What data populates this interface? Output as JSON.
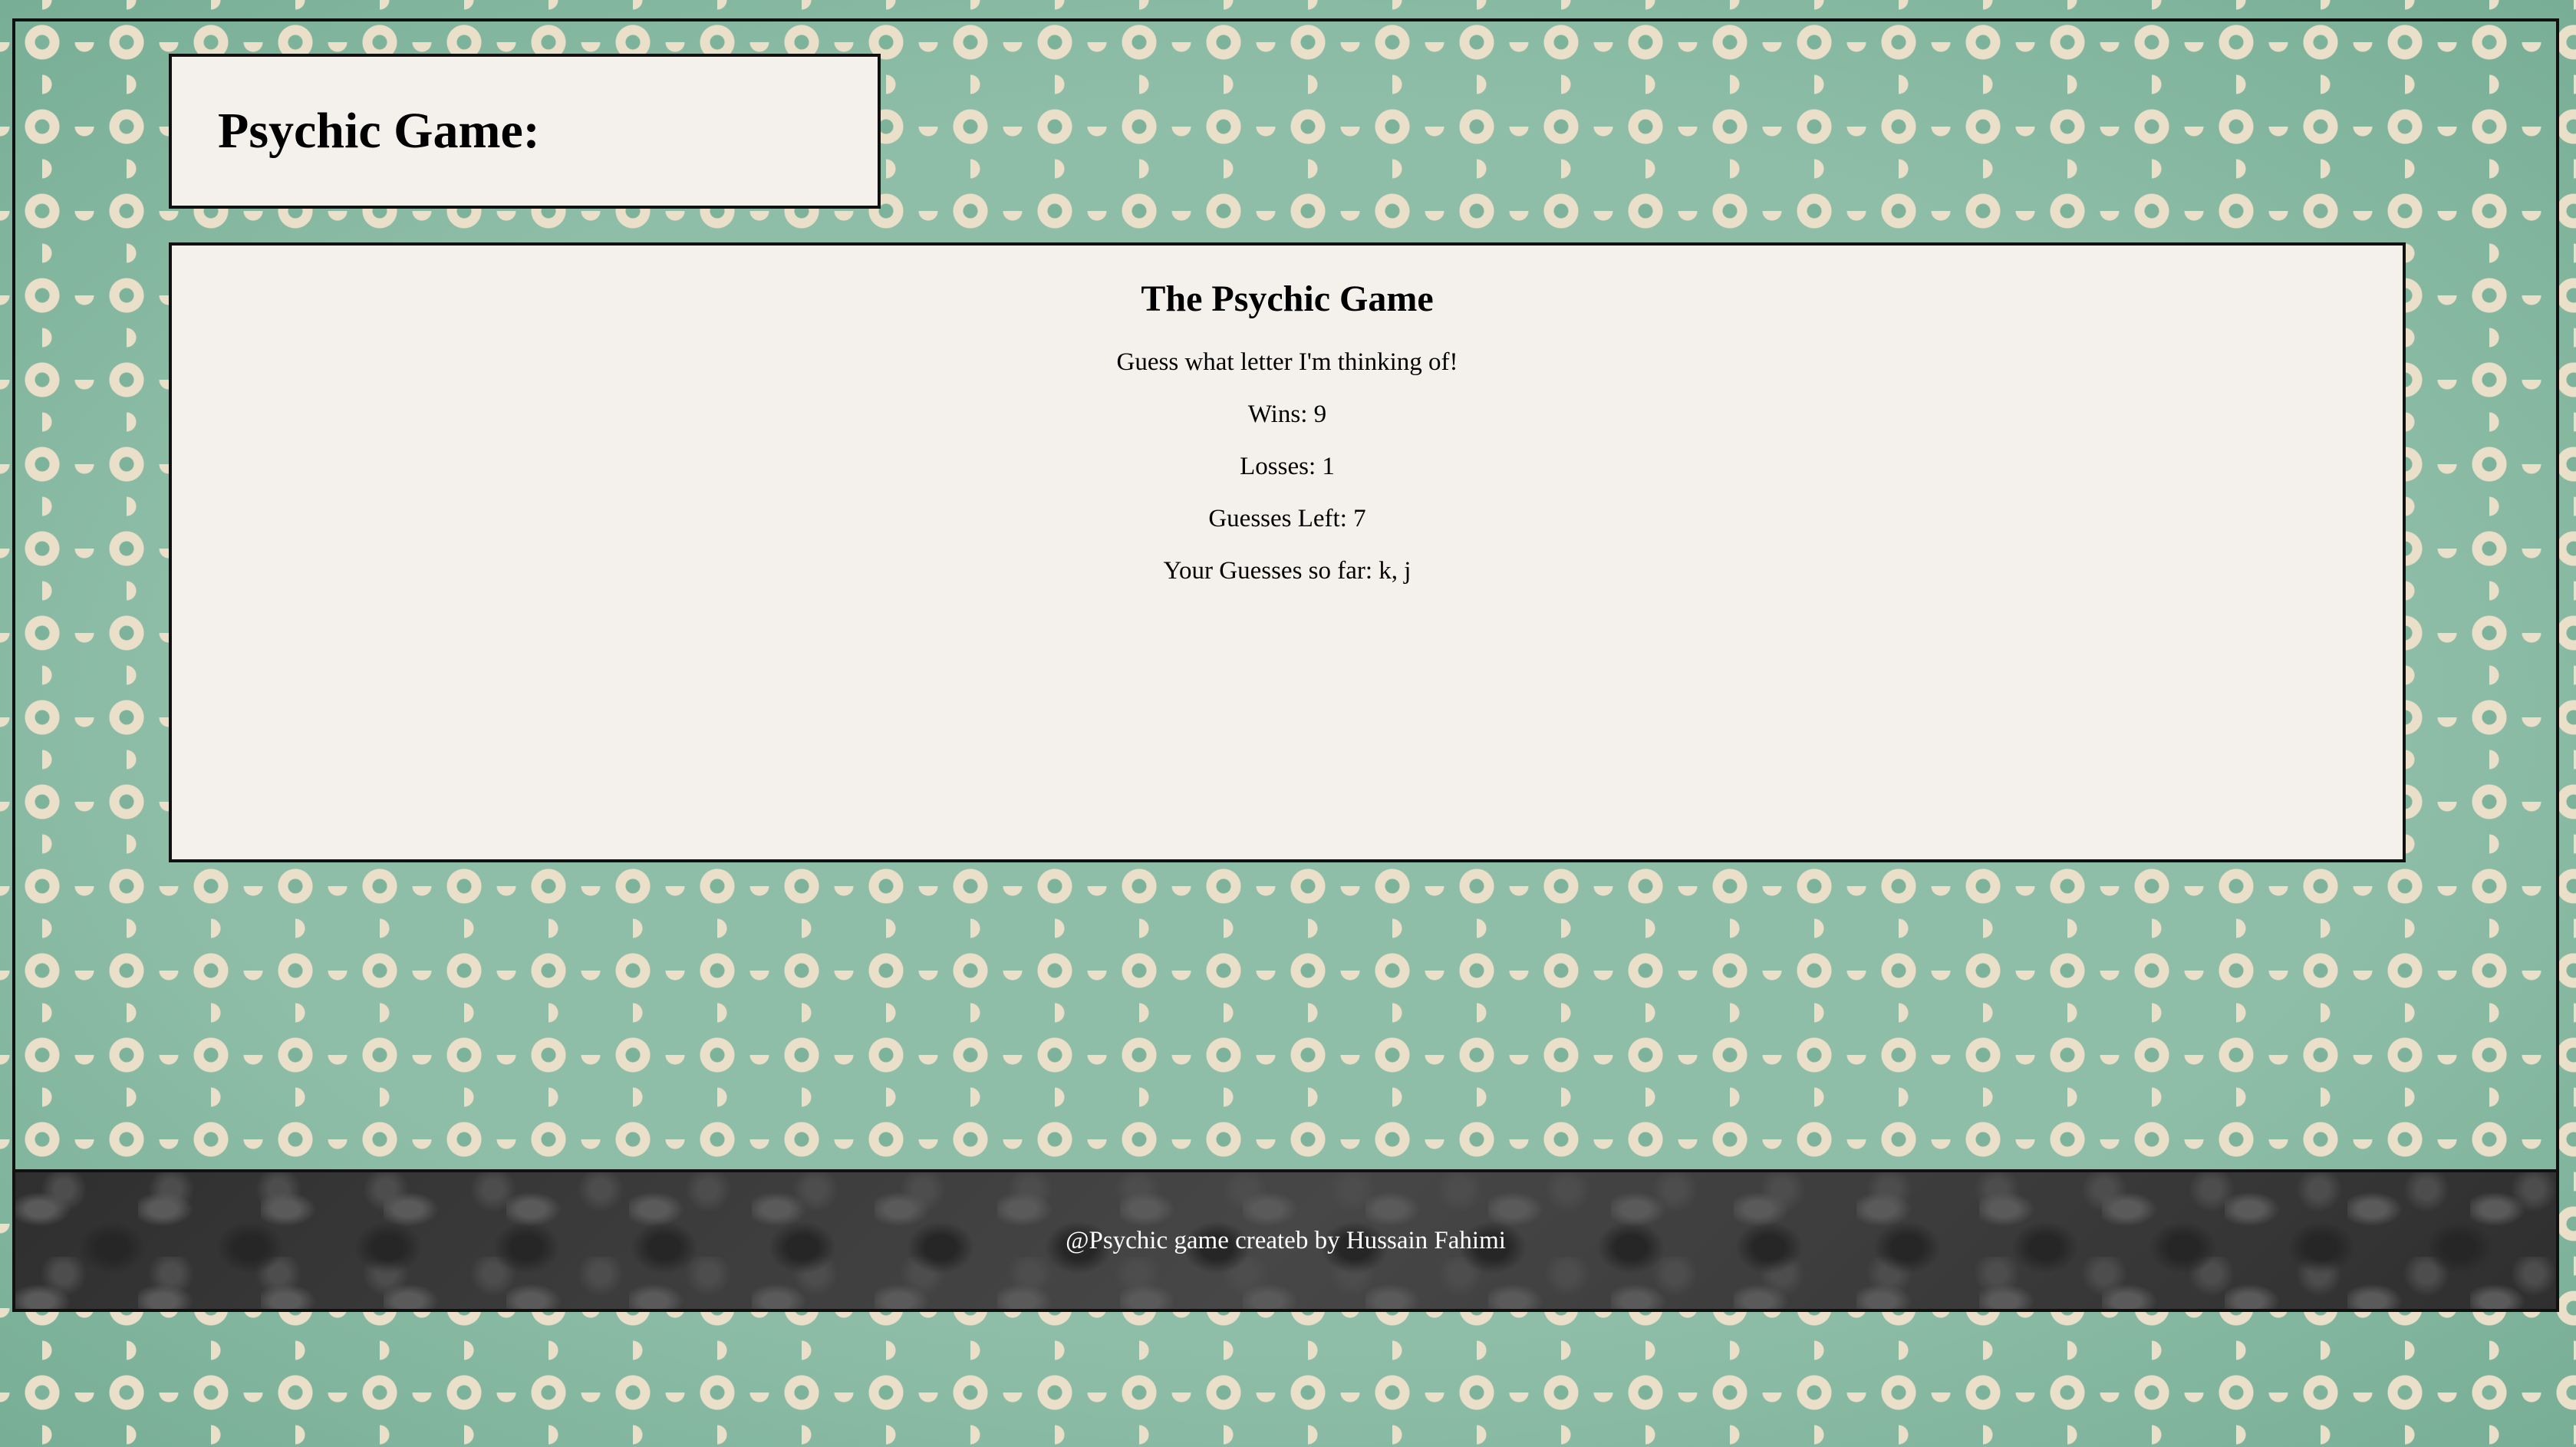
{
  "header": {
    "title": "Psychic Game:"
  },
  "game": {
    "title": "The Psychic Game",
    "prompt": "Guess what letter I'm thinking of!",
    "wins": "Wins: 9",
    "losses": "Losses: 1",
    "guesses_left": "Guesses Left: 7",
    "guesses_so_far": "Your Guesses so far: k, j"
  },
  "footer": {
    "text": "@Psychic game createb by Hussain Fahimi"
  },
  "colors": {
    "background_green": "#7db39a",
    "pattern_cream": "#eadfc8",
    "panel_bg": "#f4f1ec",
    "footer_dark": "#3a3a3a",
    "border": "#111111"
  }
}
